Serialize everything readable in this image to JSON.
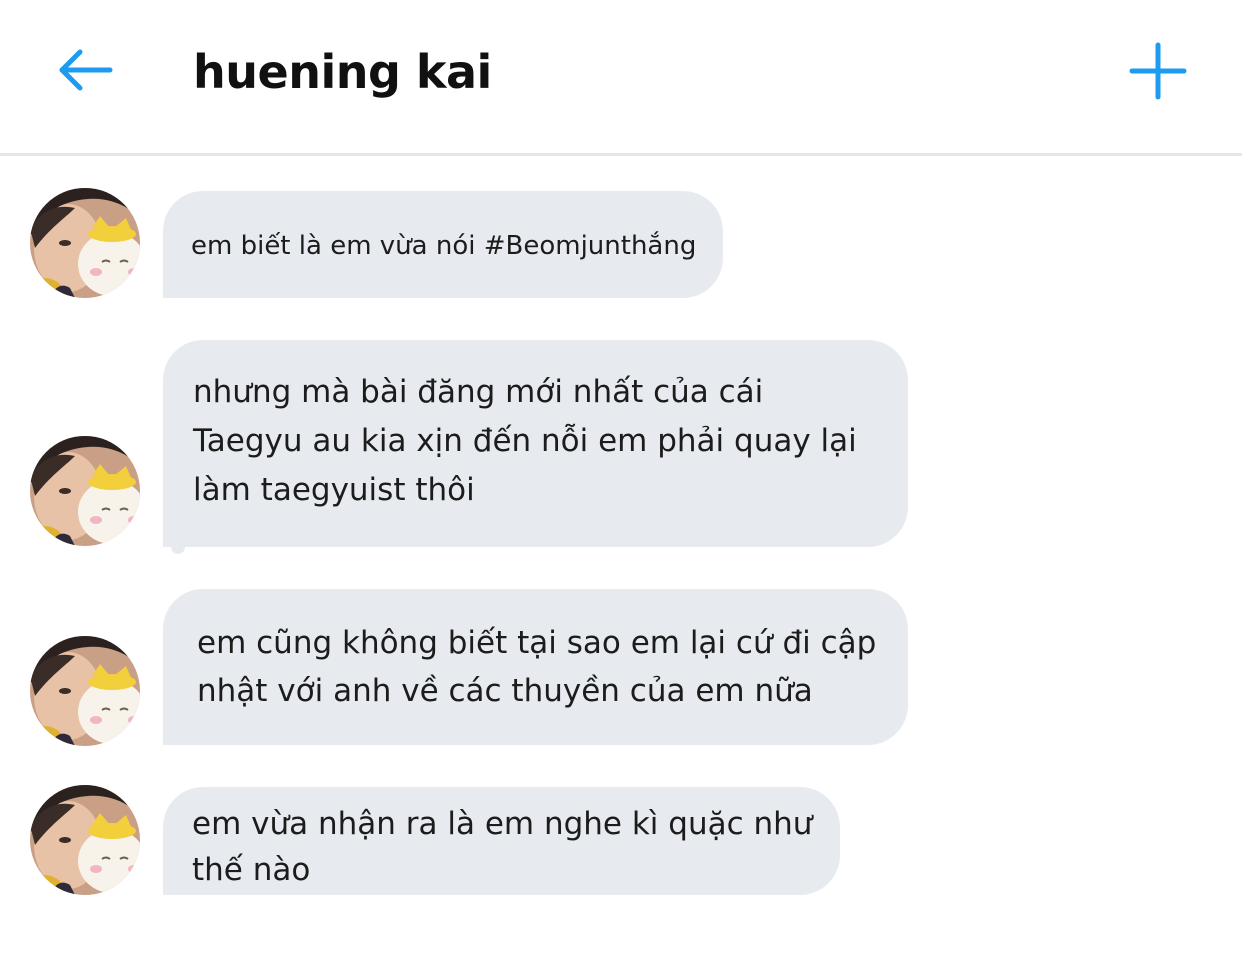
{
  "header": {
    "title": "huening kai",
    "back_icon": "arrow-left-icon",
    "add_icon": "plus-icon",
    "accent_color": "#1d9bf0"
  },
  "conversation": {
    "avatar_icon": "profile-avatar",
    "bubble_color": "#e7ebf0",
    "messages": [
      {
        "text": "em biết là em vừa nói #Beomjunthắng"
      },
      {
        "text": "nhưng mà bài đăng mới nhất của cái\nTaegyu au kia xịn đến nỗi em phải quay lại\nlàm taegyuist thôi"
      },
      {
        "text": "em cũng không biết tại sao em lại cứ đi cập\nnhật với anh về các thuyền của em nữa"
      },
      {
        "text": "em vừa nhận ra là em nghe kì quặc như\nthế nào"
      }
    ]
  }
}
